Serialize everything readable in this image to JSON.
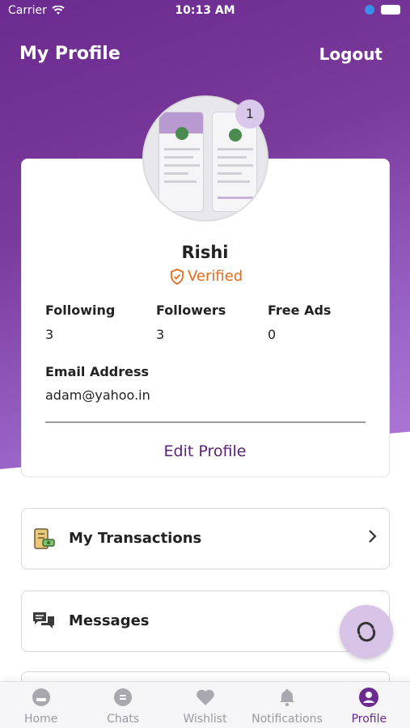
{
  "status_bar": {
    "carrier": "Carrier",
    "time": "10:13 AM"
  },
  "header": {
    "title": "My Profile",
    "logout_label": "Logout"
  },
  "profile": {
    "badge_count": "1",
    "name": "Rishi",
    "verified_label": "Verified",
    "stats": [
      {
        "label": "Following",
        "value": "3"
      },
      {
        "label": "Followers",
        "value": "3"
      },
      {
        "label": "Free Ads",
        "value": "0"
      }
    ],
    "email_label": "Email Address",
    "email_value": "adam@yahoo.in",
    "edit_label": "Edit Profile"
  },
  "menu": [
    {
      "label": "My Transactions",
      "icon": "transactions-icon"
    },
    {
      "label": "Messages",
      "icon": "messages-icon"
    }
  ],
  "tabs": [
    {
      "label": "Home",
      "icon": "home-icon"
    },
    {
      "label": "Chats",
      "icon": "chats-icon"
    },
    {
      "label": "Wishlist",
      "icon": "heart-icon"
    },
    {
      "label": "Notifications",
      "icon": "bell-icon"
    },
    {
      "label": "Profile",
      "icon": "person-icon"
    }
  ],
  "colors": {
    "brand": "#6b2a8f",
    "accent": "#e66b1b",
    "fab": "#d7c3e6"
  }
}
